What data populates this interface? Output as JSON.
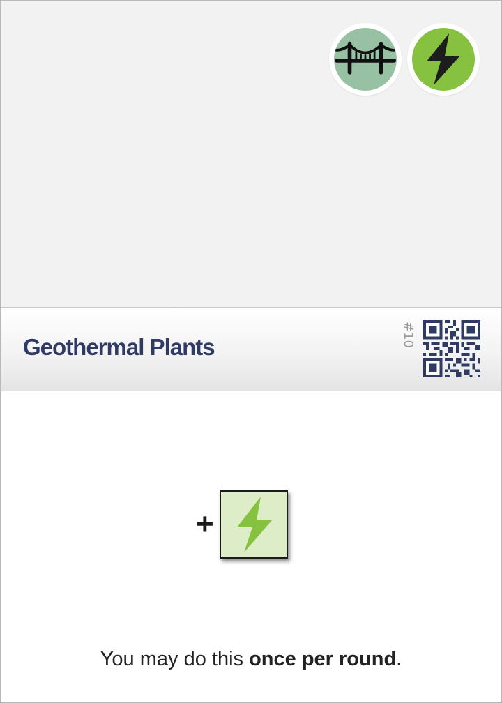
{
  "card": {
    "title": "Geothermal Plants",
    "number": "#10",
    "tags": [
      {
        "icon": "bridge-icon",
        "color": "#98c1a4"
      },
      {
        "icon": "lightning-bolt-icon",
        "color": "#86c13f"
      }
    ],
    "effect": {
      "prefix": "+",
      "resource_icon": "lightning-bolt-icon",
      "resource_bg": "#dcedc8",
      "resource_color": "#86c13f"
    },
    "rule": {
      "before": "You may do this ",
      "emphasis": "once per round",
      "after": "."
    },
    "colors": {
      "title": "#2f3b63",
      "qr": "#2f3b63"
    }
  }
}
